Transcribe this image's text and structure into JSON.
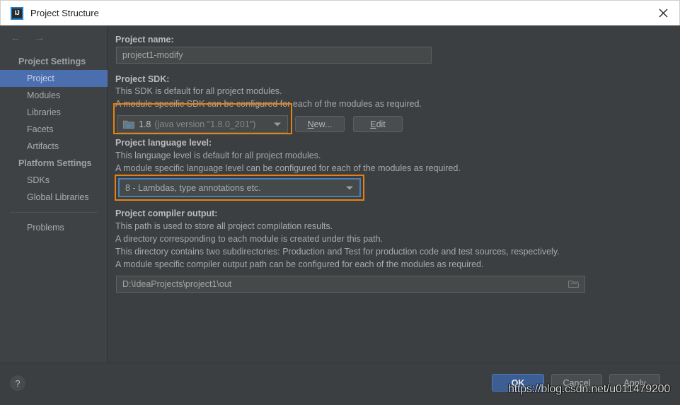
{
  "window": {
    "title": "Project Structure",
    "logo_icon": "intellij-idea-logo-icon",
    "close_icon": "close-icon"
  },
  "nav": {
    "back_icon": "arrow-left-icon",
    "forward_icon": "arrow-right-icon"
  },
  "sidebar": {
    "groups": [
      {
        "label": "Project Settings",
        "items": [
          {
            "label": "Project",
            "selected": true
          },
          {
            "label": "Modules",
            "selected": false
          },
          {
            "label": "Libraries",
            "selected": false
          },
          {
            "label": "Facets",
            "selected": false
          },
          {
            "label": "Artifacts",
            "selected": false
          }
        ]
      },
      {
        "label": "Platform Settings",
        "items": [
          {
            "label": "SDKs",
            "selected": false
          },
          {
            "label": "Global Libraries",
            "selected": false
          }
        ]
      }
    ],
    "extra": {
      "label": "Problems"
    }
  },
  "main": {
    "project_name": {
      "label": "Project name:",
      "value": "project1-modify"
    },
    "project_sdk": {
      "label": "Project SDK:",
      "desc1": "This SDK is default for all project modules.",
      "desc2": "A module specific SDK can be configured for each of the modules as required.",
      "combo_icon": "java-sdk-folder-icon",
      "combo_value_strong": "1.8",
      "combo_value_dim": "(java version \"1.8.0_201\")",
      "dropdown_icon": "chevron-down-icon",
      "new_button": "New...",
      "edit_button": "Edit",
      "highlight_color": "#e8820c"
    },
    "project_language_level": {
      "label": "Project language level:",
      "desc1": "This language level is default for all project modules.",
      "desc2": "A module specific language level can be configured for each of the modules as required.",
      "combo_value": "8 - Lambdas, type annotations etc.",
      "dropdown_icon": "chevron-down-icon",
      "focus_color": "#4b80b7",
      "highlight_color": "#e8820c"
    },
    "project_compiler_output": {
      "label": "Project compiler output:",
      "desc1": "This path is used to store all project compilation results.",
      "desc2": "A directory corresponding to each module is created under this path.",
      "desc3": "This directory contains two subdirectories: Production and Test for production code and test sources, respectively.",
      "desc4": "A module specific compiler output path can be configured for each of the modules as required.",
      "value": "D:\\IdeaProjects\\project1\\out",
      "browse_icon": "folder-browse-icon"
    }
  },
  "footer": {
    "help_label": "?",
    "help_icon": "help-question-icon",
    "ok_label": "OK",
    "cancel_label": "Cancel",
    "apply_label": "Apply",
    "ok_color": "#3c5e92"
  },
  "watermark": {
    "text": "https://blog.csdn.net/u011479200"
  }
}
